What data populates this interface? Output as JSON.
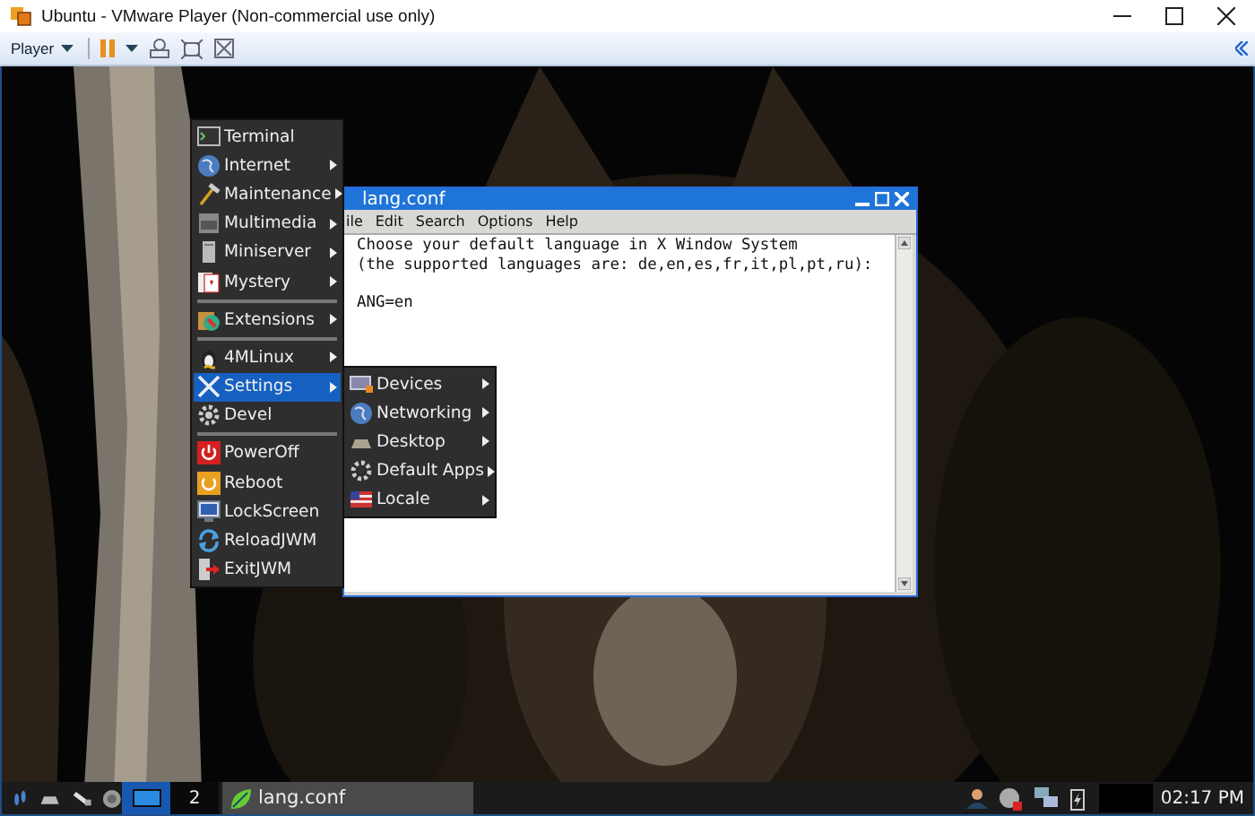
{
  "player_window": {
    "title": "Ubuntu - VMware Player (Non-commercial use only)",
    "toolbar": {
      "menu": "Player"
    }
  },
  "editor": {
    "title": "lang.conf",
    "menus": [
      "ile",
      "Edit",
      "Search",
      "Options",
      "Help"
    ],
    "paragraphs": [
      [
        "Choose your default language in X Window System",
        "(the supported languages are: de,en,es,fr,it,pl,pt,ru):"
      ],
      [
        "ANG=en"
      ]
    ]
  },
  "main_menu": {
    "groups": [
      [
        {
          "label": "Terminal",
          "submenu": false,
          "selected": false
        },
        {
          "label": "Internet",
          "submenu": true,
          "selected": false
        },
        {
          "label": "Maintenance",
          "submenu": true,
          "selected": false
        },
        {
          "label": "Multimedia",
          "submenu": true,
          "selected": false
        },
        {
          "label": "Miniserver",
          "submenu": true,
          "selected": false
        },
        {
          "label": "Mystery",
          "submenu": true,
          "selected": false
        }
      ],
      [
        {
          "label": "Extensions",
          "submenu": true,
          "selected": false
        }
      ],
      [
        {
          "label": "4MLinux",
          "submenu": true,
          "selected": false
        },
        {
          "label": "Settings",
          "submenu": true,
          "selected": true
        },
        {
          "label": "Devel",
          "submenu": false,
          "selected": false
        }
      ],
      [
        {
          "label": "PowerOff",
          "submenu": false,
          "selected": false
        },
        {
          "label": "Reboot",
          "submenu": false,
          "selected": false
        },
        {
          "label": "LockScreen",
          "submenu": false,
          "selected": false
        },
        {
          "label": "ReloadJWM",
          "submenu": false,
          "selected": false
        },
        {
          "label": "ExitJWM",
          "submenu": false,
          "selected": false
        }
      ]
    ]
  },
  "settings_submenu": {
    "items": [
      {
        "label": "Devices",
        "submenu": true
      },
      {
        "label": "Networking",
        "submenu": true
      },
      {
        "label": "Desktop",
        "submenu": true
      },
      {
        "label": "Default Apps",
        "submenu": true
      },
      {
        "label": "Locale",
        "submenu": true
      }
    ]
  },
  "taskbar": {
    "workspaces": [
      {
        "selected": true
      },
      {
        "label": "2",
        "selected": false
      }
    ],
    "tasks": [
      {
        "label": "lang.conf"
      }
    ],
    "clock": "02:17 PM"
  }
}
